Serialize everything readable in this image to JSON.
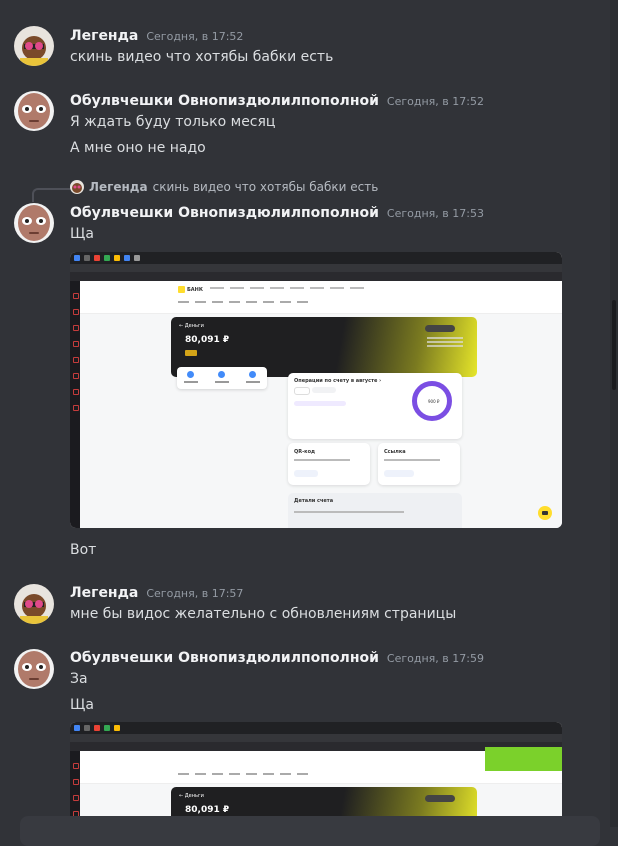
{
  "messages": [
    {
      "author": "Легенда",
      "time": "Сегодня, в 17:52",
      "lines": [
        "скинь видео что хотябы бабки есть"
      ]
    },
    {
      "author": "Обулвчешки Овнопиздюлилпополной",
      "time": "Сегодня, в 17:52",
      "lines": [
        "Я ждать буду только месяц",
        "А мне оно не надо"
      ]
    },
    {
      "reply_to": {
        "author": "Легенда",
        "text": "скинь видео что хотябы бабки есть"
      },
      "author": "Обулвчешки Овнопиздюлилпополной",
      "time": "Сегодня, в 17:53",
      "lines": [
        "Ща"
      ],
      "after_attachment": "Вот"
    },
    {
      "author": "Легенда",
      "time": "Сегодня, в 17:57",
      "lines": [
        "мне бы видос желательно с обновлениям страницы"
      ]
    },
    {
      "author": "Обулвчешки Овнопиздюлилпополной",
      "time": "Сегодня, в 17:59",
      "lines": [
        "За",
        "Ща"
      ]
    }
  ],
  "attachment_1": {
    "bank_logo": "БАНК",
    "account_title": "← Деньги",
    "balance": "80,091 ₽",
    "operations_title": "Операции по счету в августе  ›",
    "ring_amount": "900 ₽",
    "qr_title": "QR-код",
    "link_title": "Ссылка",
    "details_title": "Детали счета"
  },
  "attachment_2": {
    "account_title": "← Деньги",
    "balance": "80,091 ₽"
  },
  "colors": {
    "background": "#313338",
    "author": "#f2f3f5",
    "timestamp": "#949ba4",
    "text": "#dbdee1",
    "bank_yellow": "#ffdd2d",
    "ring_purple": "#7b4ee3"
  }
}
